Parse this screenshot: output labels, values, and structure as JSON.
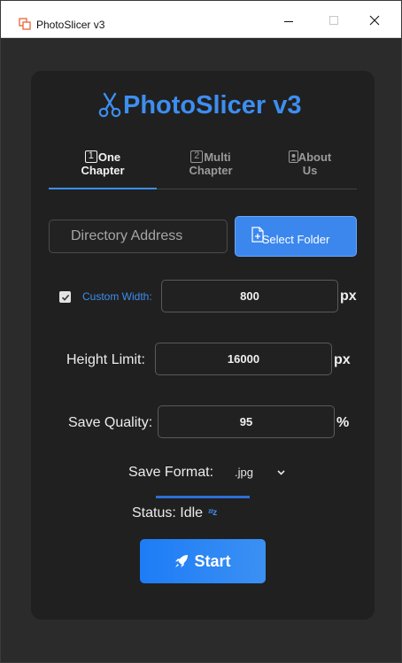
{
  "window": {
    "title": "PhotoSlicer v3"
  },
  "brand": {
    "title": "PhotoSlicer v3",
    "icon": "scissors-icon"
  },
  "tabs": [
    {
      "num": "1",
      "line1": "One",
      "line2": "Chapter",
      "active": true
    },
    {
      "num": "2",
      "line1": "Multi",
      "line2": "Chapter",
      "active": false
    },
    {
      "num": "",
      "line1": "About",
      "line2": "Us",
      "active": false
    }
  ],
  "directory": {
    "placeholder": "Directory Address",
    "value": ""
  },
  "select_folder": {
    "label": "Select Folder",
    "icon": "file-add-icon"
  },
  "custom_width": {
    "checked": true,
    "label": "Custom Width:",
    "value": "800",
    "unit": "px"
  },
  "height_limit": {
    "label": "Height Limit:",
    "value": "16000",
    "unit": "px"
  },
  "save_quality": {
    "label": "Save Quality:",
    "value": "95",
    "unit": "%"
  },
  "save_format": {
    "label": "Save Format:",
    "value": ".jpg",
    "icon": "chevron-down-icon"
  },
  "status": {
    "text": "Status: Idle",
    "icon": "sleep-zzz-icon"
  },
  "start": {
    "label": "Start",
    "icon": "rocket-icon"
  },
  "colors": {
    "accent": "#3d8ef0",
    "panel": "#202020",
    "background": "#2b2b2b"
  }
}
